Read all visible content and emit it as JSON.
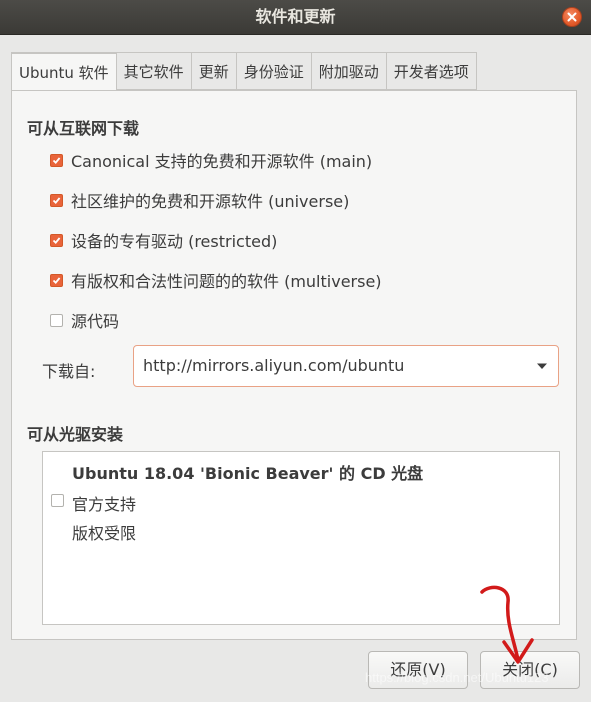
{
  "window": {
    "title": "软件和更新"
  },
  "tabs": [
    {
      "label": "Ubuntu 软件",
      "active": true
    },
    {
      "label": "其它软件"
    },
    {
      "label": "更新"
    },
    {
      "label": "身份验证"
    },
    {
      "label": "附加驱动"
    },
    {
      "label": "开发者选项"
    }
  ],
  "internet": {
    "title": "可从互联网下载",
    "items": [
      {
        "label": "Canonical 支持的免费和开源软件 (main)",
        "checked": true
      },
      {
        "label": "社区维护的免费和开源软件 (universe)",
        "checked": true
      },
      {
        "label": "设备的专有驱动 (restricted)",
        "checked": true
      },
      {
        "label": "有版权和合法性问题的的软件 (multiverse)",
        "checked": true
      },
      {
        "label": "源代码",
        "checked": false
      }
    ],
    "download_from_label": "下载自:",
    "download_from_value": "http://mirrors.aliyun.com/ubuntu"
  },
  "cdrom": {
    "title": "可从光驱安装",
    "disc_title": "Ubuntu 18.04 'Bionic Beaver' 的 CD 光盘",
    "line1": "官方支持",
    "line2": "版权受限",
    "checked": false
  },
  "buttons": {
    "revert": "还原(V)",
    "close": "关闭(C)"
  },
  "watermark": "https://blog.csdn.net/Ubuntu123",
  "colors": {
    "accent": "#e9643a",
    "titlebar": "#3f3e3a"
  }
}
